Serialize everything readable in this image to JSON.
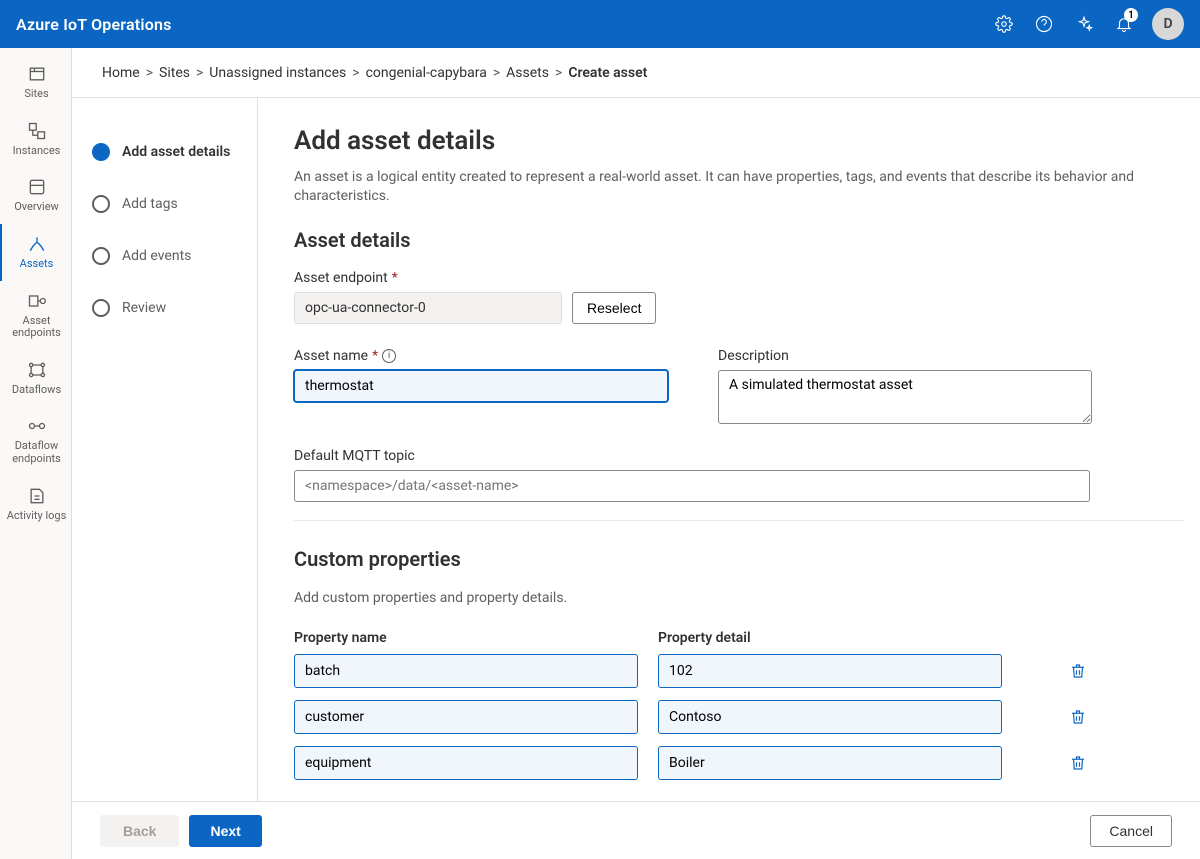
{
  "topbar": {
    "title": "Azure IoT Operations",
    "notification_count": "1",
    "avatar_initial": "D"
  },
  "left_nav": {
    "items": [
      {
        "id": "sites",
        "label": "Sites"
      },
      {
        "id": "instances",
        "label": "Instances"
      },
      {
        "id": "overview",
        "label": "Overview"
      },
      {
        "id": "assets",
        "label": "Assets"
      },
      {
        "id": "asset-endpoints",
        "label": "Asset endpoints"
      },
      {
        "id": "dataflows",
        "label": "Dataflows"
      },
      {
        "id": "dataflow-endpoints",
        "label": "Dataflow endpoints"
      },
      {
        "id": "activity-logs",
        "label": "Activity logs"
      }
    ],
    "active_id": "assets"
  },
  "breadcrumb": {
    "items": [
      "Home",
      "Sites",
      "Unassigned instances",
      "congenial-capybara",
      "Assets",
      "Create asset"
    ]
  },
  "steps": {
    "items": [
      {
        "label": "Add asset details",
        "current": true
      },
      {
        "label": "Add tags",
        "current": false
      },
      {
        "label": "Add events",
        "current": false
      },
      {
        "label": "Review",
        "current": false
      }
    ]
  },
  "page": {
    "title": "Add asset details",
    "intro": "An asset is a logical entity created to represent a real-world asset. It can have properties, tags, and events that describe its behavior and characteristics.",
    "section_asset_details": "Asset details",
    "asset_endpoint_label": "Asset endpoint",
    "asset_endpoint_value": "opc-ua-connector-0",
    "reselect_label": "Reselect",
    "asset_name_label": "Asset name",
    "asset_name_value": "thermostat",
    "description_label": "Description",
    "description_value": "A simulated thermostat asset",
    "mqtt_label": "Default MQTT topic",
    "mqtt_placeholder": "<namespace>/data/<asset-name>",
    "section_custom_props": "Custom properties",
    "custom_props_intro": "Add custom properties and property details.",
    "prop_name_header": "Property name",
    "prop_detail_header": "Property detail",
    "properties": [
      {
        "name": "batch",
        "detail": "102"
      },
      {
        "name": "customer",
        "detail": "Contoso"
      },
      {
        "name": "equipment",
        "detail": "Boiler"
      }
    ]
  },
  "footer": {
    "back": "Back",
    "next": "Next",
    "cancel": "Cancel"
  }
}
